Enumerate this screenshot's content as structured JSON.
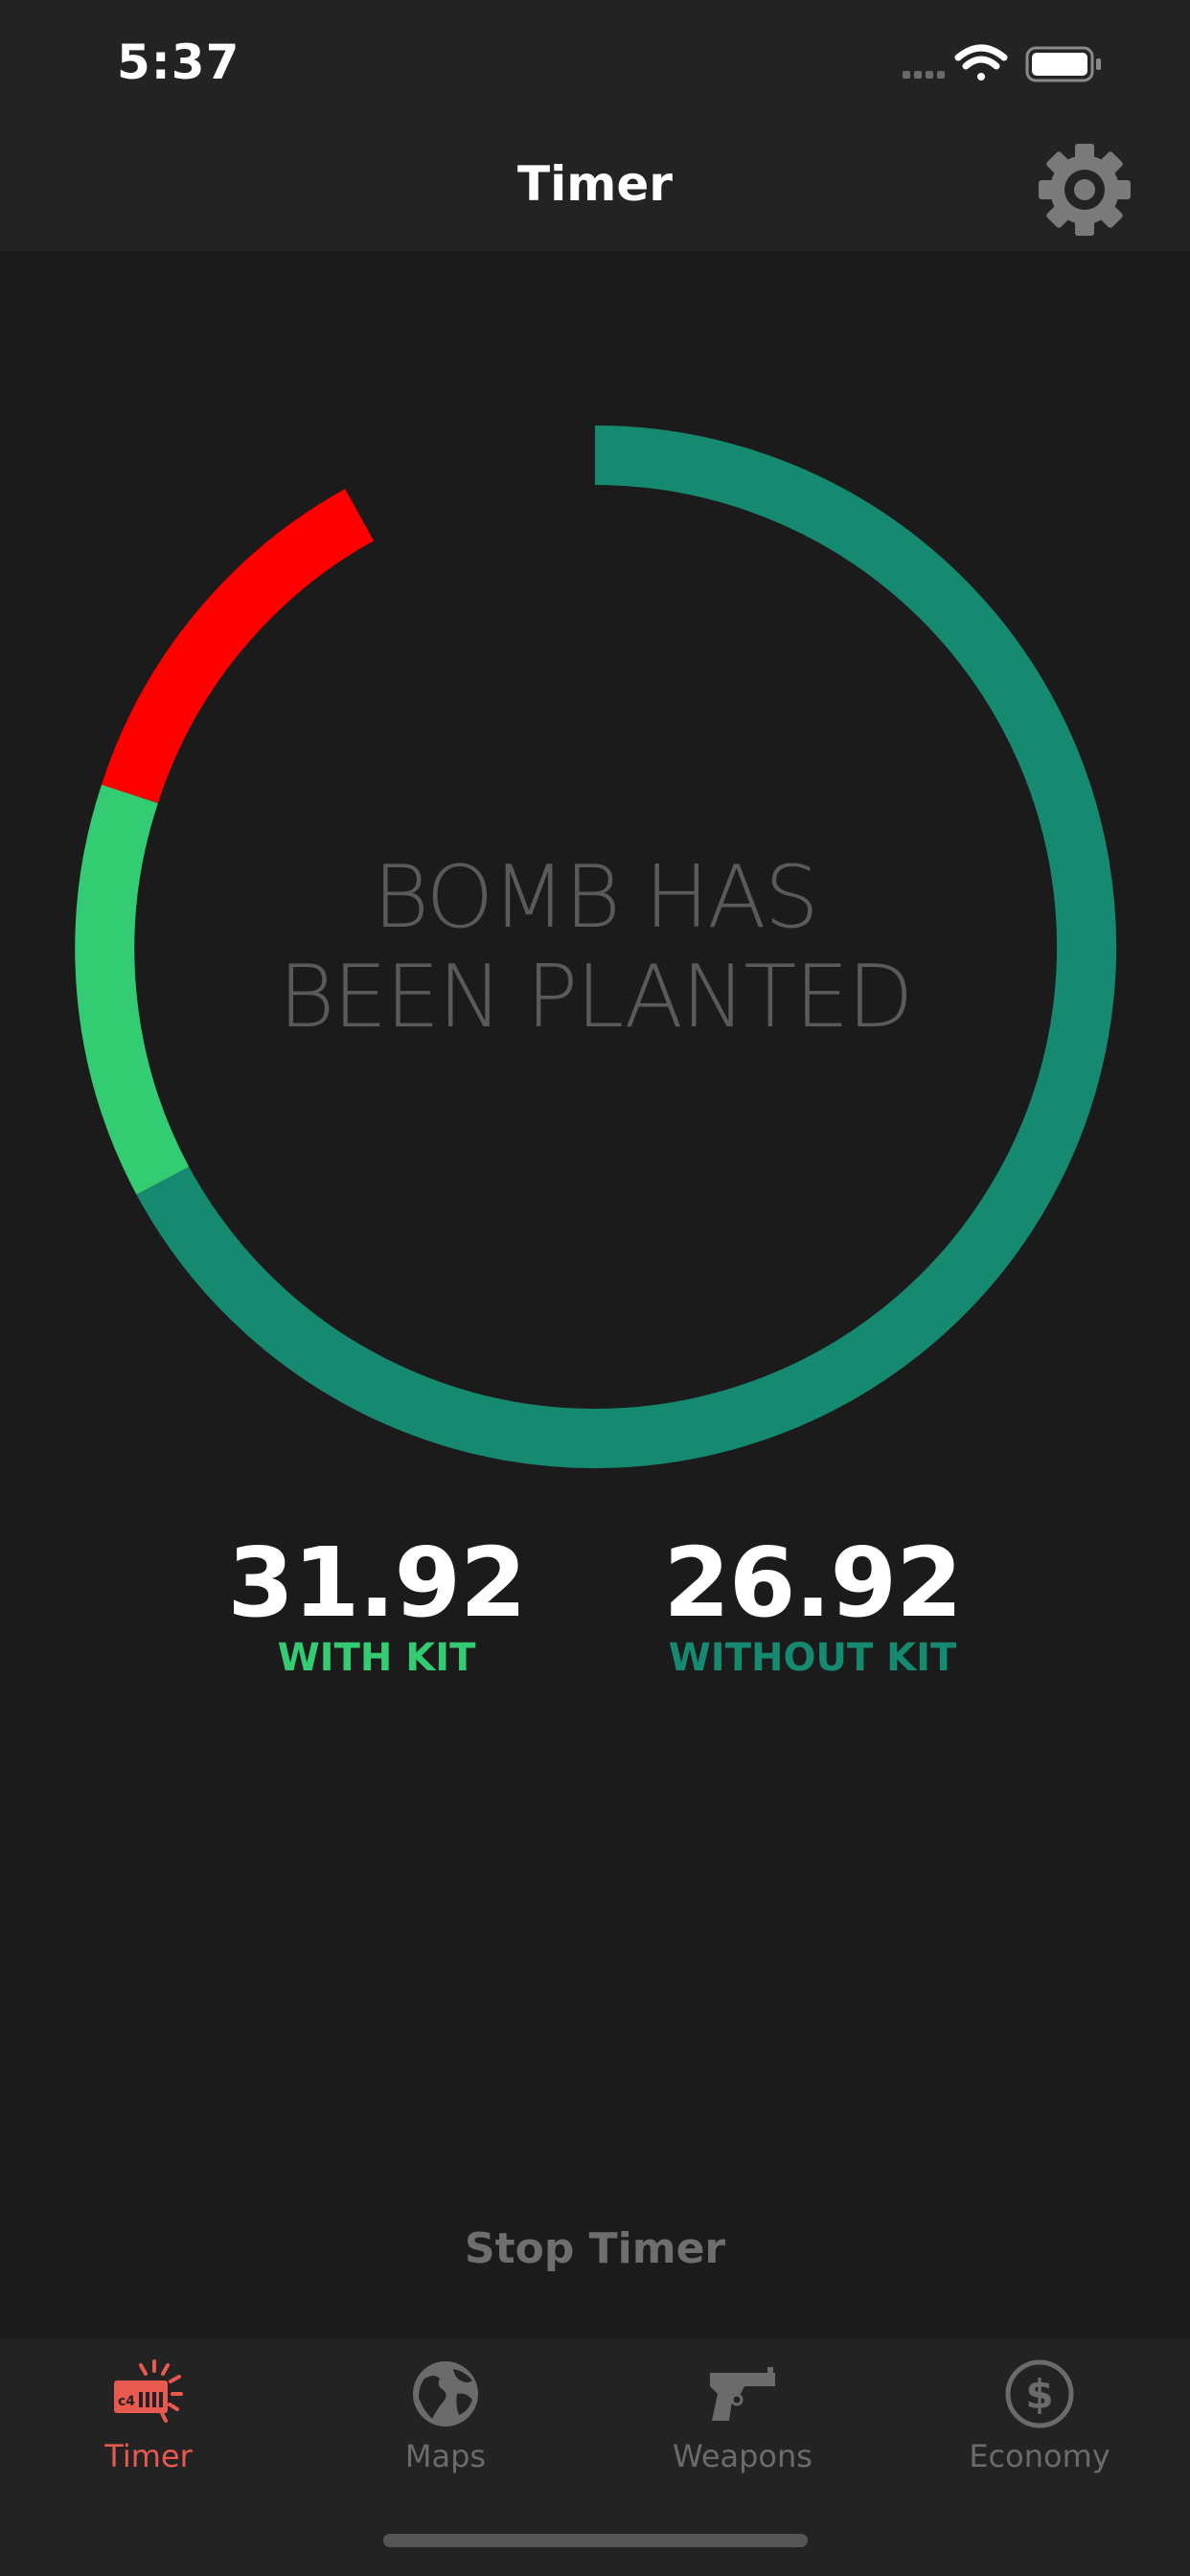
{
  "status_bar": {
    "time": "5:37"
  },
  "nav": {
    "title": "Timer",
    "settings_icon": "gear-icon"
  },
  "timer": {
    "headline_line1": "BOMB HAS",
    "headline_line2": "BEEN PLANTED",
    "with_kit": {
      "value": "31.92",
      "label": "WITH KIT"
    },
    "without_kit": {
      "value": "26.92",
      "label": "WITHOUT KIT"
    },
    "colors": {
      "remaining": "#168a70",
      "with_kit_window": "#33cc73",
      "critical": "#ff0000"
    },
    "stop_label": "Stop Timer"
  },
  "tab_bar": {
    "active_color": "#e85a50",
    "items": [
      {
        "label": "Timer",
        "icon": "c4-bomb-icon",
        "active": true
      },
      {
        "label": "Maps",
        "icon": "globe-icon",
        "active": false
      },
      {
        "label": "Weapons",
        "icon": "pistol-icon",
        "active": false
      },
      {
        "label": "Economy",
        "icon": "dollar-icon",
        "active": false
      }
    ]
  }
}
